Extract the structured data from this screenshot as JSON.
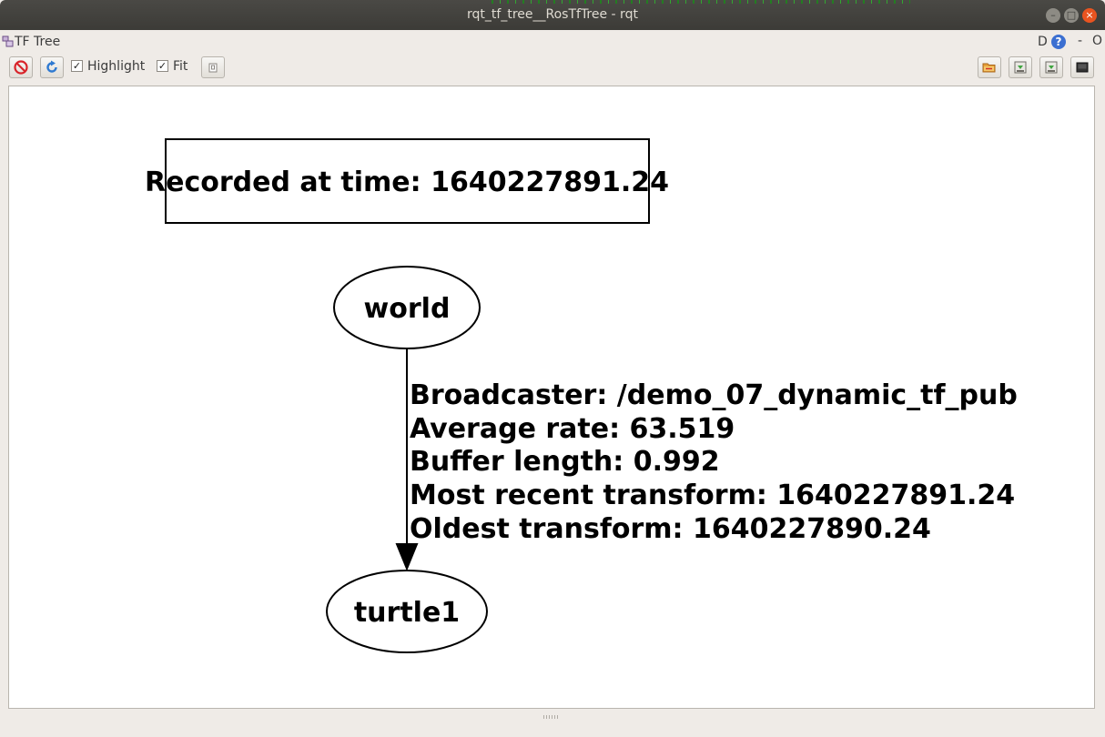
{
  "window": {
    "title": "rqt_tf_tree__RosTfTree - rqt",
    "minimize_icon": "minimize-icon",
    "maximize_icon": "maximize-icon",
    "close_icon": "close-icon"
  },
  "plugin": {
    "title": "TF Tree",
    "d_label": "D",
    "help_label": "?",
    "dash_label": "-",
    "o_label": "O"
  },
  "toolbar": {
    "highlight_label": "Highlight",
    "highlight_checked": true,
    "fit_label": "Fit",
    "fit_checked": true,
    "check_mark": "✓"
  },
  "graph": {
    "recorded_label": "Recorded at time: 1640227891.24",
    "nodes": {
      "world": "world",
      "turtle1": "turtle1"
    },
    "edge_info": [
      "Broadcaster: /demo_07_dynamic_tf_pub",
      "Average rate: 63.519",
      "Buffer length: 0.992",
      "Most recent transform: 1640227891.24",
      "Oldest transform: 1640227890.24"
    ]
  }
}
